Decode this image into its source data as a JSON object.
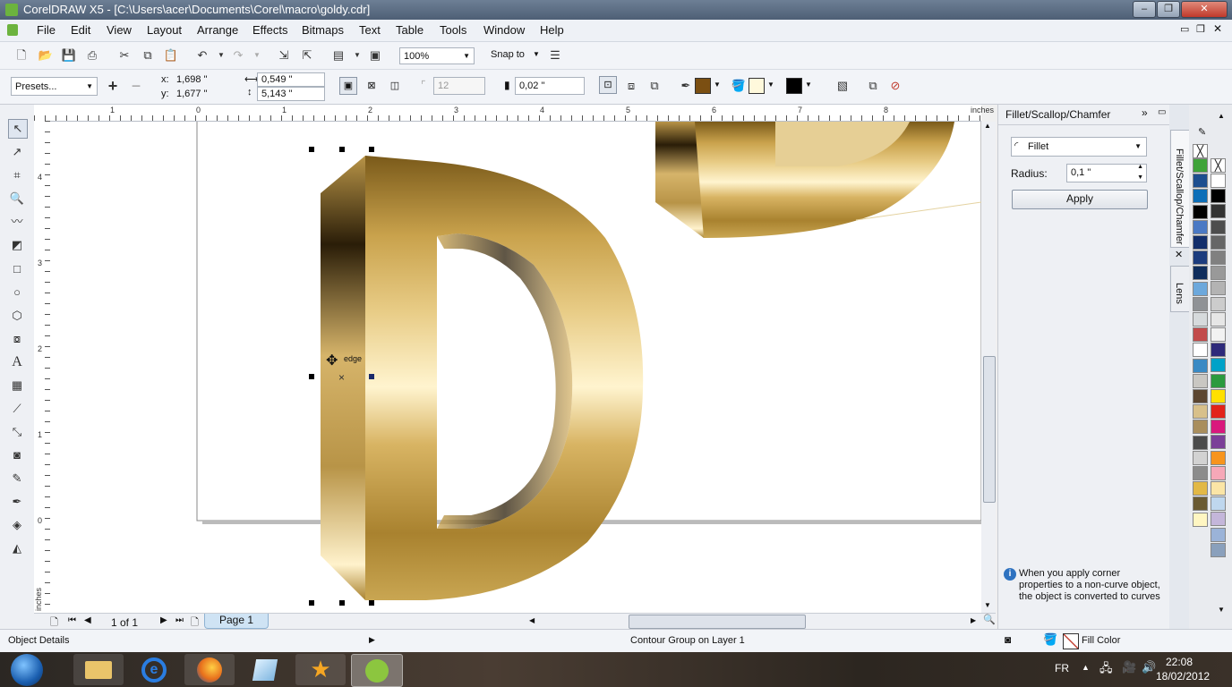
{
  "window": {
    "title": "CorelDRAW X5 - [C:\\Users\\acer\\Documents\\Corel\\macro\\goldy.cdr]"
  },
  "menu": [
    "File",
    "Edit",
    "View",
    "Layout",
    "Arrange",
    "Effects",
    "Bitmaps",
    "Text",
    "Table",
    "Tools",
    "Window",
    "Help"
  ],
  "standard_toolbar": {
    "zoom": "100%",
    "snap_to": "Snap to"
  },
  "property_bar": {
    "presets": "Presets...",
    "x_label": "x:",
    "x_value": "1,698 \"",
    "y_label": "y:",
    "y_value": "1,677 \"",
    "width_value": "0,549 \"",
    "height_value": "5,143 \"",
    "corner_value": "12",
    "outline_value": "0,02 \""
  },
  "rulers": {
    "unit": "inches",
    "h_ticks": [
      "1",
      "0",
      "1",
      "2",
      "3",
      "4",
      "5",
      "6",
      "7",
      "8"
    ],
    "v_ticks": [
      "4",
      "3",
      "2",
      "1",
      "0"
    ]
  },
  "canvas": {
    "cursor_label": "edge"
  },
  "page_nav": {
    "counter": "1 of 1",
    "page_tab": "Page 1"
  },
  "docker": {
    "title": "Fillet/Scallop/Chamfer",
    "mode": "Fillet",
    "radius_label": "Radius:",
    "radius_value": "0,1 \"",
    "apply_label": "Apply",
    "info_text": "When you apply corner properties to a non-curve object, the object is converted to curves",
    "tab_active": "Fillet/Scallop/Chamfer",
    "tab_other": "Lens"
  },
  "palette_colors": [
    "#ffffff",
    "#3ea339",
    "#1d4e8f",
    "#0d6fb8",
    "#000000",
    "#4a79c4",
    "#122e6b",
    "#1c3c7e",
    "#0f2d5c",
    "#6ca8dc",
    "#8f9296",
    "#d6dadc",
    "#c24b4b",
    "#ffffff",
    "#3a8ac4",
    "#c9c7c2",
    "#5c4630",
    "#d8c08a",
    "#a98e5d",
    "#4b4b4b",
    "#d2d2d2",
    "#8c8c8c",
    "#e2b846",
    "#6a5a32",
    "#fff6c2"
  ],
  "palette_colors2": [
    "#ffffff",
    "#000000",
    "#333333",
    "#4d4d4d",
    "#666666",
    "#808080",
    "#999999",
    "#b3b3b3",
    "#cccccc",
    "#e6e6e6",
    "#f2f2f2",
    "#2e2a7a",
    "#00a2c8",
    "#2b9a3e",
    "#ffe000",
    "#e2231a",
    "#d9187d",
    "#7b3f98",
    "#f7941d",
    "#f6a8b8",
    "#fbe5a6",
    "#bfd7ee",
    "#c4b6da",
    "#9bb3d8",
    "#8aa0bc"
  ],
  "status": {
    "left": "Object Details",
    "center": "Contour Group on Layer 1",
    "fill": "Fill Color"
  },
  "taskbar": {
    "lang": "FR",
    "time": "22:08",
    "date": "18/02/2012"
  },
  "icons": [
    "pick-tool-icon",
    "shape-tool-icon",
    "crop-tool-icon",
    "zoom-tool-icon",
    "freehand-tool-icon",
    "smart-fill-icon",
    "rectangle-tool-icon",
    "ellipse-tool-icon",
    "polygon-tool-icon",
    "basic-shapes-icon",
    "text-tool-icon",
    "table-tool-icon",
    "dimension-tool-icon",
    "connector-tool-icon",
    "interactive-tool-icon",
    "eyedropper-icon",
    "outline-pen-icon",
    "fill-tool-icon",
    "interactive-fill-icon"
  ]
}
